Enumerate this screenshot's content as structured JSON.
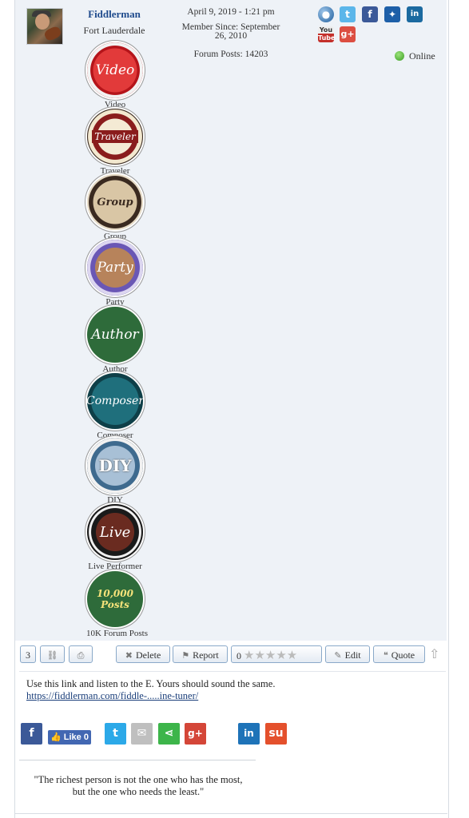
{
  "user": {
    "name": "Fiddlerman",
    "location": "Fort Lauderdale",
    "status": "Online"
  },
  "post_meta": {
    "date": "April 9, 2019 - 1:21 pm",
    "member_since_line1": "Member Since: September",
    "member_since_line2": "26, 2010",
    "forum_posts": "Forum Posts: 14203"
  },
  "profile_icons": [
    "website-icon",
    "twitter-icon",
    "facebook-icon",
    "myspace-icon",
    "linkedin-icon",
    "youtube-icon",
    "google-plus-icon"
  ],
  "badges": [
    {
      "label": "Video",
      "icon": "video-badge",
      "text": "Video",
      "color": "#d2232a"
    },
    {
      "label": "Traveler",
      "icon": "traveler-badge",
      "text": "Traveler",
      "color": "#8a1c1c"
    },
    {
      "label": "Group",
      "icon": "group-badge",
      "text": "Group",
      "color": "#7a5c3a"
    },
    {
      "label": "Party",
      "icon": "party-badge",
      "text": "Party",
      "color": "#6a57b5"
    },
    {
      "label": "Author",
      "icon": "author-badge",
      "text": "Author",
      "color": "#2e6b3a"
    },
    {
      "label": "Composer",
      "icon": "composer-badge",
      "text": "Composer",
      "color": "#1c5f6b"
    },
    {
      "label": "DIY",
      "icon": "diy-badge",
      "text": "DIY",
      "color": "#3e6a8e"
    },
    {
      "label": "Live Performer",
      "icon": "live-performer-badge",
      "text": "Live",
      "color": "#3a2a22"
    },
    {
      "label": "10K Forum Posts",
      "icon": "10k-posts-badge",
      "text": "10,000 Posts",
      "color": "#2e6b3a"
    }
  ],
  "toolbar": {
    "post_number": "3",
    "delete_label": "Delete",
    "report_label": "Report",
    "rating_value": "0",
    "rating_max": 5,
    "edit_label": "Edit",
    "quote_label": "Quote"
  },
  "message": {
    "text": "Use this link and listen to the E. Yours should sound the same.",
    "link": "https://fiddlerman.com/fiddle-.....ine-tuner/"
  },
  "share": {
    "like_label": "Like",
    "like_count": "0",
    "icons": [
      "facebook-icon",
      "twitter-icon",
      "email-icon",
      "share-icon",
      "google-plus-icon",
      "linkedin-icon",
      "stumbleupon-icon"
    ]
  },
  "signature": {
    "line1": "\"The richest person is not the one who has the most,",
    "line2": "but the one who needs the least.\""
  },
  "colors": {
    "username": "#1e4a8c",
    "panel": "#eef2f7",
    "online": "#3a9d22"
  }
}
